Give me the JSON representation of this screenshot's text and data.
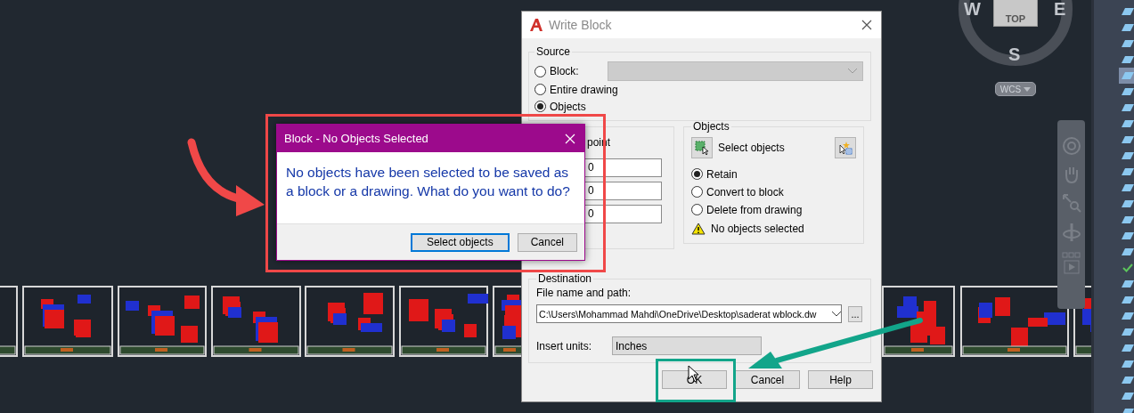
{
  "viewcube": {
    "west": "W",
    "east": "E",
    "south": "S",
    "top": "TOP",
    "ucs": "WCS"
  },
  "right_panel": {
    "items": [
      {
        "kind": "layer",
        "selected": false
      },
      {
        "kind": "layer",
        "selected": false
      },
      {
        "kind": "layer",
        "selected": false
      },
      {
        "kind": "layer",
        "selected": false
      },
      {
        "kind": "layer",
        "selected": true
      },
      {
        "kind": "layer",
        "selected": false
      },
      {
        "kind": "layer",
        "selected": false
      },
      {
        "kind": "layer",
        "selected": false
      },
      {
        "kind": "layer",
        "selected": false
      },
      {
        "kind": "layer",
        "selected": false
      },
      {
        "kind": "layer",
        "selected": false
      },
      {
        "kind": "layer",
        "selected": false
      },
      {
        "kind": "layer",
        "selected": false
      },
      {
        "kind": "layer",
        "selected": false
      },
      {
        "kind": "layer",
        "selected": false
      },
      {
        "kind": "layer",
        "selected": false
      },
      {
        "kind": "check",
        "selected": false
      },
      {
        "kind": "layer",
        "selected": false
      },
      {
        "kind": "layer",
        "selected": false
      },
      {
        "kind": "layer",
        "selected": false
      },
      {
        "kind": "layer",
        "selected": false
      },
      {
        "kind": "layer",
        "selected": false
      },
      {
        "kind": "layer",
        "selected": false
      },
      {
        "kind": "layer",
        "selected": false
      },
      {
        "kind": "layer",
        "selected": false
      },
      {
        "kind": "layer",
        "selected": false
      }
    ]
  },
  "write_block": {
    "title": "Write Block",
    "source": {
      "label": "Source",
      "options": [
        {
          "label": "Block:",
          "selected": false
        },
        {
          "label": "Entire drawing",
          "selected": false
        },
        {
          "label": "Objects",
          "selected": true
        }
      ],
      "block_dropdown": {
        "disabled": true
      }
    },
    "base_point": {
      "pick_label": "point",
      "values": [
        "0",
        "0",
        "0"
      ]
    },
    "objects": {
      "label": "Objects",
      "select_button": "Select objects",
      "options": [
        {
          "label": "Retain",
          "selected": true
        },
        {
          "label": "Convert to block",
          "selected": false
        },
        {
          "label": "Delete from drawing",
          "selected": false
        }
      ],
      "warning": "No objects selected"
    },
    "destination": {
      "label": "Destination",
      "file_label": "File name and path:",
      "file_value": "C:\\Users\\Mohammad Mahdi\\OneDrive\\Desktop\\saderat wblock.dw",
      "browse": "...",
      "units_label": "Insert units:",
      "units_value": "Inches"
    },
    "buttons": [
      "OK",
      "Cancel",
      "Help"
    ]
  },
  "message_box": {
    "title": "Block - No Objects Selected",
    "text": "No objects have been selected to be saved as a block or a drawing. What do you want to do?",
    "buttons": [
      {
        "label": "Select objects",
        "focused": true
      },
      {
        "label": "Cancel",
        "focused": false
      }
    ]
  }
}
